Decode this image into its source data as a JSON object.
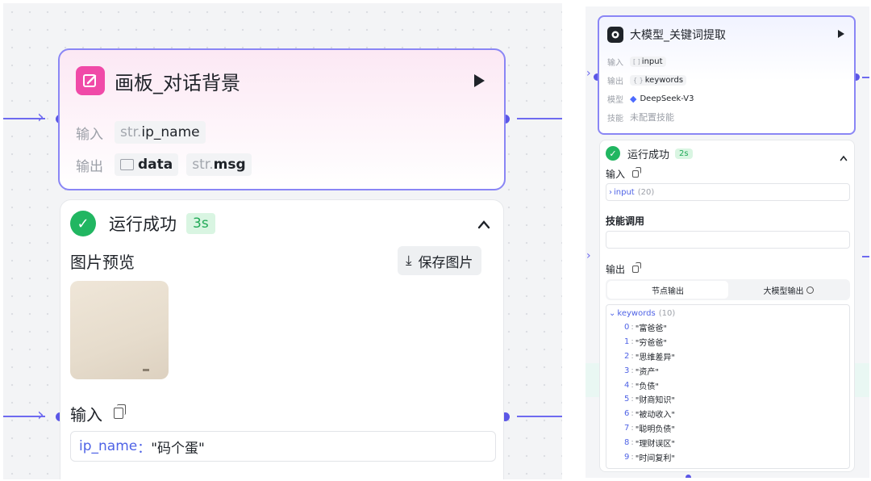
{
  "left": {
    "node": {
      "title": "画板_对话背景",
      "input_label": "输入",
      "input_type": "str.",
      "input_name": "ip_name",
      "output_label": "输出",
      "output1_name": "data",
      "output2_type": "str.",
      "output2_name": "msg"
    },
    "result": {
      "status": "运行成功",
      "duration": "3s",
      "preview_title": "图片预览",
      "save_button": "保存图片",
      "input_title": "输入",
      "input_key": "ip_name",
      "input_sep": "：",
      "input_value": "\"码个蛋\""
    }
  },
  "right": {
    "node": {
      "title": "大模型_关键词提取",
      "input_label": "输入",
      "input_tag": "[ ]",
      "input_name": "input",
      "output_label": "输出",
      "output_tag": "{ }",
      "output_name": "keywords",
      "model_label": "模型",
      "model_name": "DeepSeek-V3",
      "skill_label": "技能",
      "skill_value": "未配置技能"
    },
    "result": {
      "status": "运行成功",
      "duration": "2s",
      "input_title": "输入",
      "input_key": "input",
      "input_count": "(20)",
      "skill_title": "技能调用",
      "output_title": "输出",
      "tab_node": "节点输出",
      "tab_llm": "大模型输出",
      "output_key": "keywords",
      "output_count": "(10)",
      "items": [
        {
          "index": "0",
          "value": "\"富爸爸\""
        },
        {
          "index": "1",
          "value": "\"穷爸爸\""
        },
        {
          "index": "2",
          "value": "\"思维差异\""
        },
        {
          "index": "3",
          "value": "\"资产\""
        },
        {
          "index": "4",
          "value": "\"负债\""
        },
        {
          "index": "5",
          "value": "\"财商知识\""
        },
        {
          "index": "6",
          "value": "\"被动收入\""
        },
        {
          "index": "7",
          "value": "\"聪明负债\""
        },
        {
          "index": "8",
          "value": "\"理财误区\""
        },
        {
          "index": "9",
          "value": "\"时间复利\""
        }
      ]
    }
  },
  "colors": {
    "edge": "#6e6af0",
    "success": "#21b661",
    "node_icon": "#f04aa8",
    "keyword": "#4f63e6"
  }
}
